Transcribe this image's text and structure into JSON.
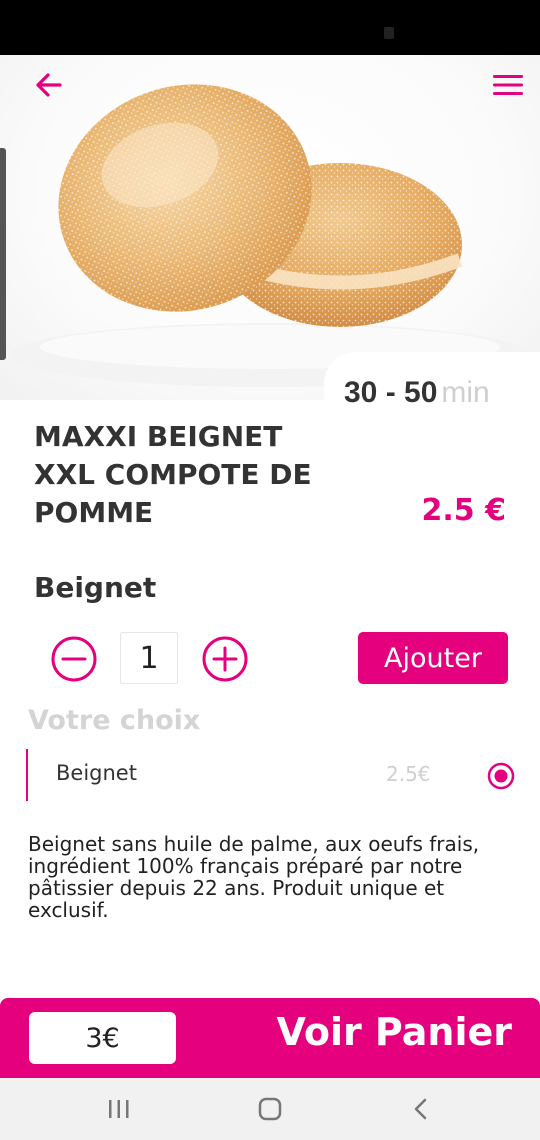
{
  "header": {
    "back_icon": "arrow-left-icon",
    "menu_icon": "hamburger-menu-icon"
  },
  "product": {
    "image_icon": "beignet-photo",
    "delivery_time": "30 - 50",
    "delivery_unit": "min",
    "title": "MAXXI BEIGNET XXL COMPOTE DE POMME",
    "category": "Beignet",
    "price": "2.5 €",
    "description": "Beignet sans huile de palme, aux oeufs frais, ingrédient 100% français préparé par notre pâtissier depuis 22 ans. Produit unique et exclusif."
  },
  "quantity": {
    "value": "1",
    "decrement_icon": "minus-circle-icon",
    "increment_icon": "plus-circle-icon"
  },
  "add_button": {
    "label": "Ajouter"
  },
  "choices": {
    "heading": "Votre choix",
    "options": [
      {
        "label": "Beignet",
        "price": "2.5€",
        "selected": true
      }
    ]
  },
  "cart": {
    "total": "3€",
    "label": "Voir Panier"
  },
  "system_nav": {
    "recents_icon": "recents-icon",
    "home_icon": "home-icon",
    "back_icon": "nav-back-icon"
  },
  "colors": {
    "accent": "#e5007e",
    "text": "#333333",
    "muted": "#cfcfcf"
  }
}
